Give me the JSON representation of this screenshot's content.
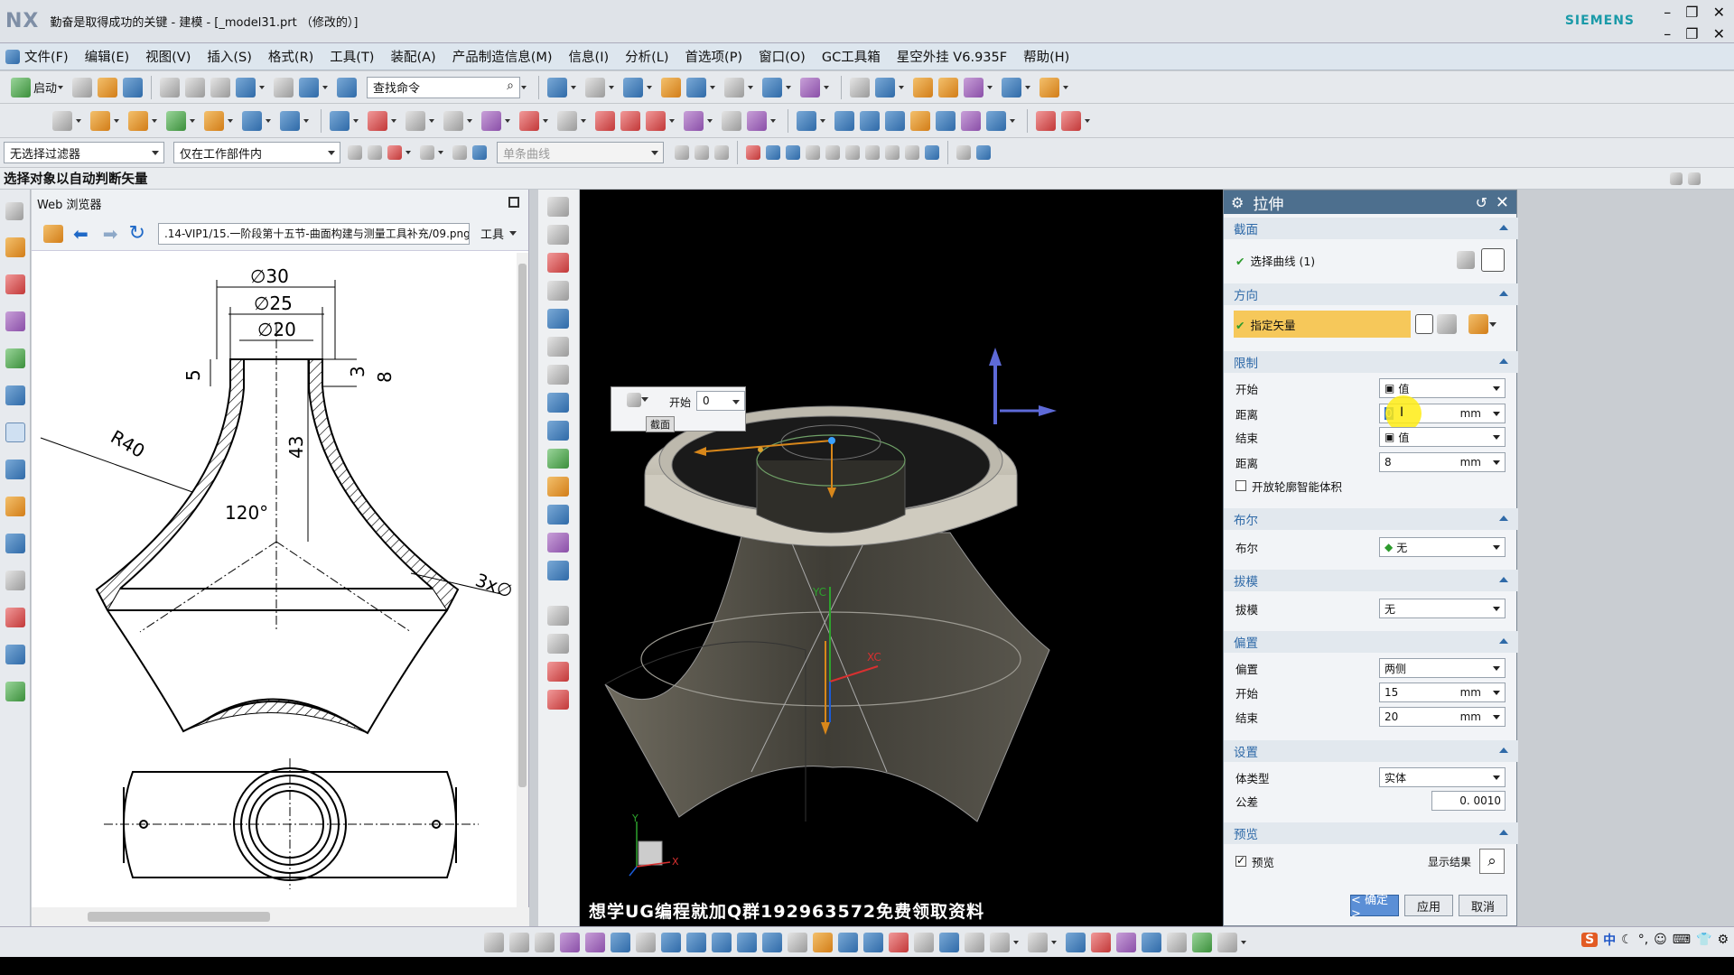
{
  "window": {
    "logo": "NX",
    "title": "勤奋是取得成功的关键 - 建模 - [_model31.prt （修改的）]",
    "brand": "SIEMENS",
    "min": "–",
    "restore": "❐",
    "close": "✕"
  },
  "menu": [
    "文件(F)",
    "编辑(E)",
    "视图(V)",
    "插入(S)",
    "格式(R)",
    "工具(T)",
    "装配(A)",
    "产品制造信息(M)",
    "信息(I)",
    "分析(L)",
    "首选项(P)",
    "窗口(O)",
    "GC工具箱",
    "星空外挂 V6.935F",
    "帮助(H)"
  ],
  "toolbar": {
    "start_label": "启动",
    "search_placeholder": "查找命令",
    "filter_value": "无选择过滤器",
    "scope_value": "仅在工作部件内",
    "curve_rule": "单条曲线"
  },
  "status_line": "选择对象以自动判断矢量",
  "browser": {
    "title": "Web 浏览器",
    "url": ".14-VIP1/15.一阶段第十五节-曲面构建与测量工具补充/09.png",
    "tools_label": "工具",
    "drawing": {
      "dims": [
        "∅30",
        "∅25",
        "∅20",
        "5",
        "3",
        "8",
        "43",
        "R40",
        "120°",
        "3x∅"
      ]
    }
  },
  "graphics": {
    "mini_bar": {
      "start_label": "开始",
      "start_value": "0",
      "tag": "截面"
    },
    "axis_labels": [
      "YC",
      "XC"
    ],
    "triad_labels": [
      "Y",
      "X"
    ],
    "watermark": "想学UG编程就加Q群192963572免费领取资料"
  },
  "dialog": {
    "title": "拉伸",
    "section": {
      "header": "截面",
      "select_curve": "选择曲线 (1)"
    },
    "direction": {
      "header": "方向",
      "specify_vector": "指定矢量"
    },
    "limits": {
      "header": "限制",
      "start_label": "开始",
      "start_value": "值",
      "start_dist_label": "距离",
      "start_dist_value": "0",
      "start_dist_unit": "mm",
      "end_label": "结束",
      "end_value": "值",
      "end_dist_label": "距离",
      "end_dist_value": "8",
      "end_dist_unit": "mm",
      "open_profile": "开放轮廓智能体积"
    },
    "boolean": {
      "header": "布尔",
      "label": "布尔",
      "value": "无"
    },
    "draft": {
      "header": "拔模",
      "label": "拔模",
      "value": "无"
    },
    "offset": {
      "header": "偏置",
      "label": "偏置",
      "value": "两侧",
      "start_label": "开始",
      "start_value": "15",
      "start_unit": "mm",
      "end_label": "结束",
      "end_value": "20",
      "end_unit": "mm"
    },
    "settings": {
      "header": "设置",
      "body_type_label": "体类型",
      "body_type_value": "实体",
      "tolerance_label": "公差",
      "tolerance_value": "0. 0010"
    },
    "preview": {
      "header": "预览",
      "preview_label": "预览",
      "show_result": "显示结果"
    },
    "buttons": {
      "ok": "< 确定 >",
      "apply": "应用",
      "cancel": "取消"
    }
  },
  "tray": {
    "ime": "S",
    "lang": "中"
  },
  "colors": {
    "dialog_header": "#4d6f8e",
    "section_text": "#2f6aa8",
    "vector_highlight": "#f6c85a",
    "ok_button": "#5b8fd6"
  }
}
